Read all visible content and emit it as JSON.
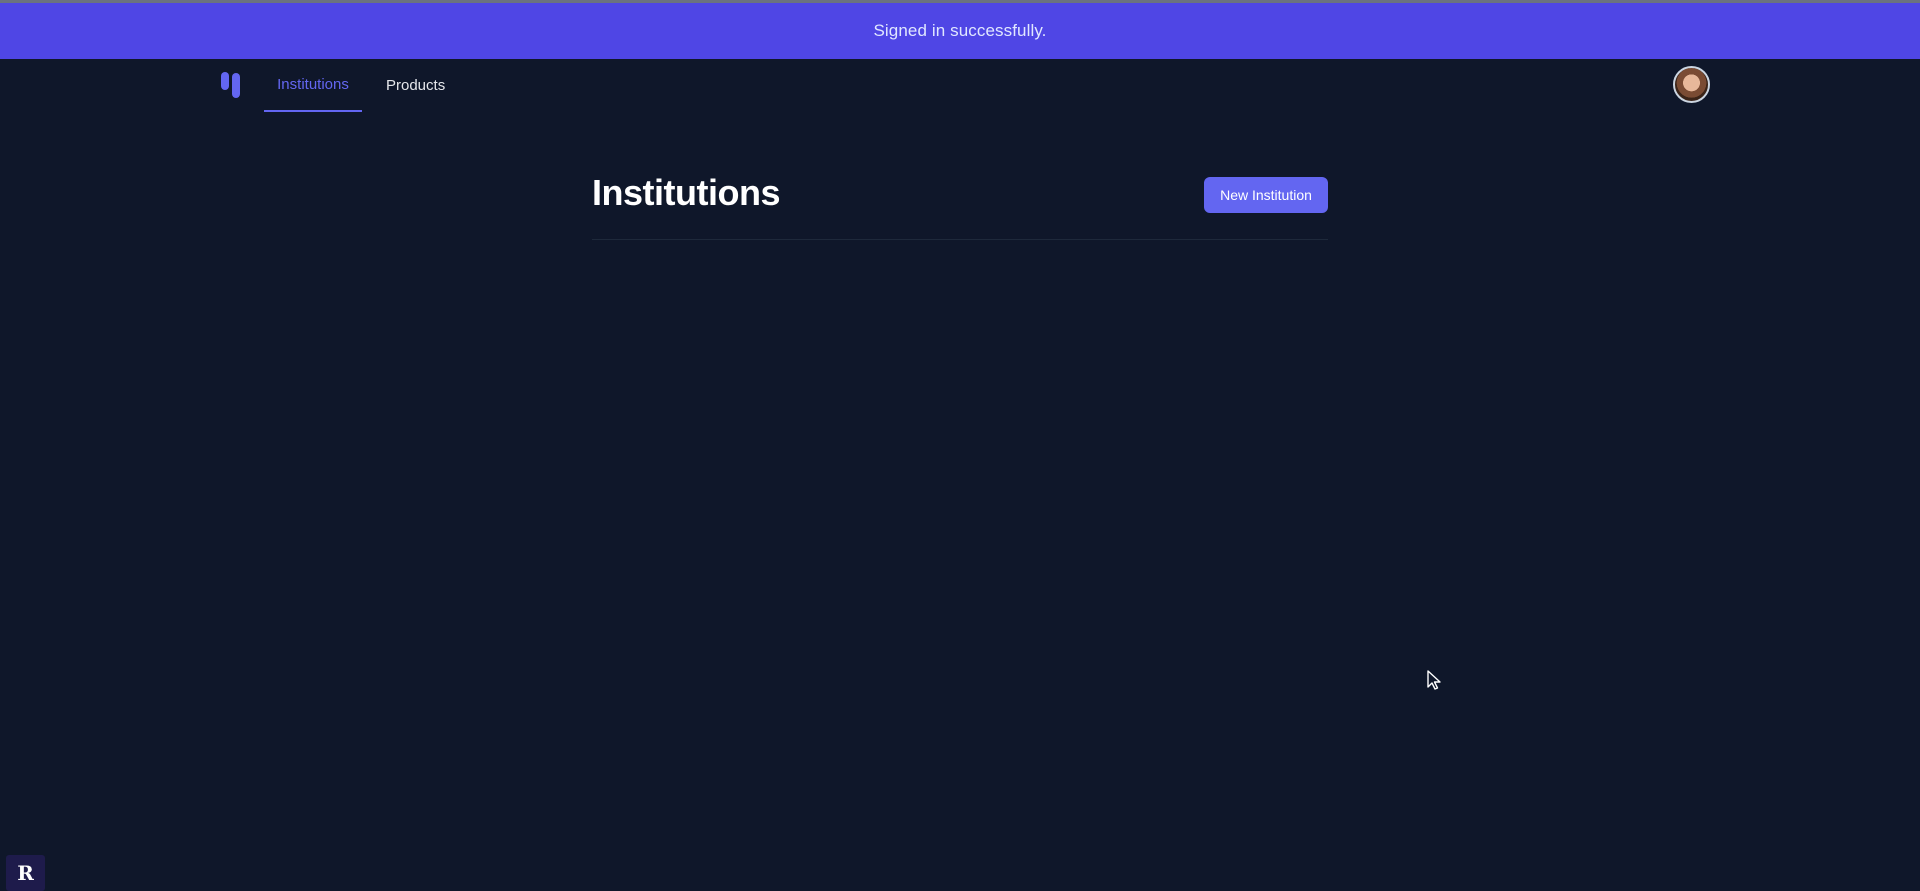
{
  "flash": {
    "message": "Signed in successfully."
  },
  "nav": {
    "links": [
      {
        "label": "Institutions",
        "active": true
      },
      {
        "label": "Products",
        "active": false
      }
    ]
  },
  "main": {
    "title": "Institutions",
    "new_button_label": "New Institution"
  },
  "corner_badge": {
    "glyph": "R"
  },
  "colors": {
    "background": "#0f172a",
    "accent": "#6366f1",
    "flash_background": "#4f46e5"
  },
  "icons": {
    "logo": "app-logo-icon",
    "avatar": "user-avatar",
    "cursor": "mouse-cursor-icon"
  }
}
